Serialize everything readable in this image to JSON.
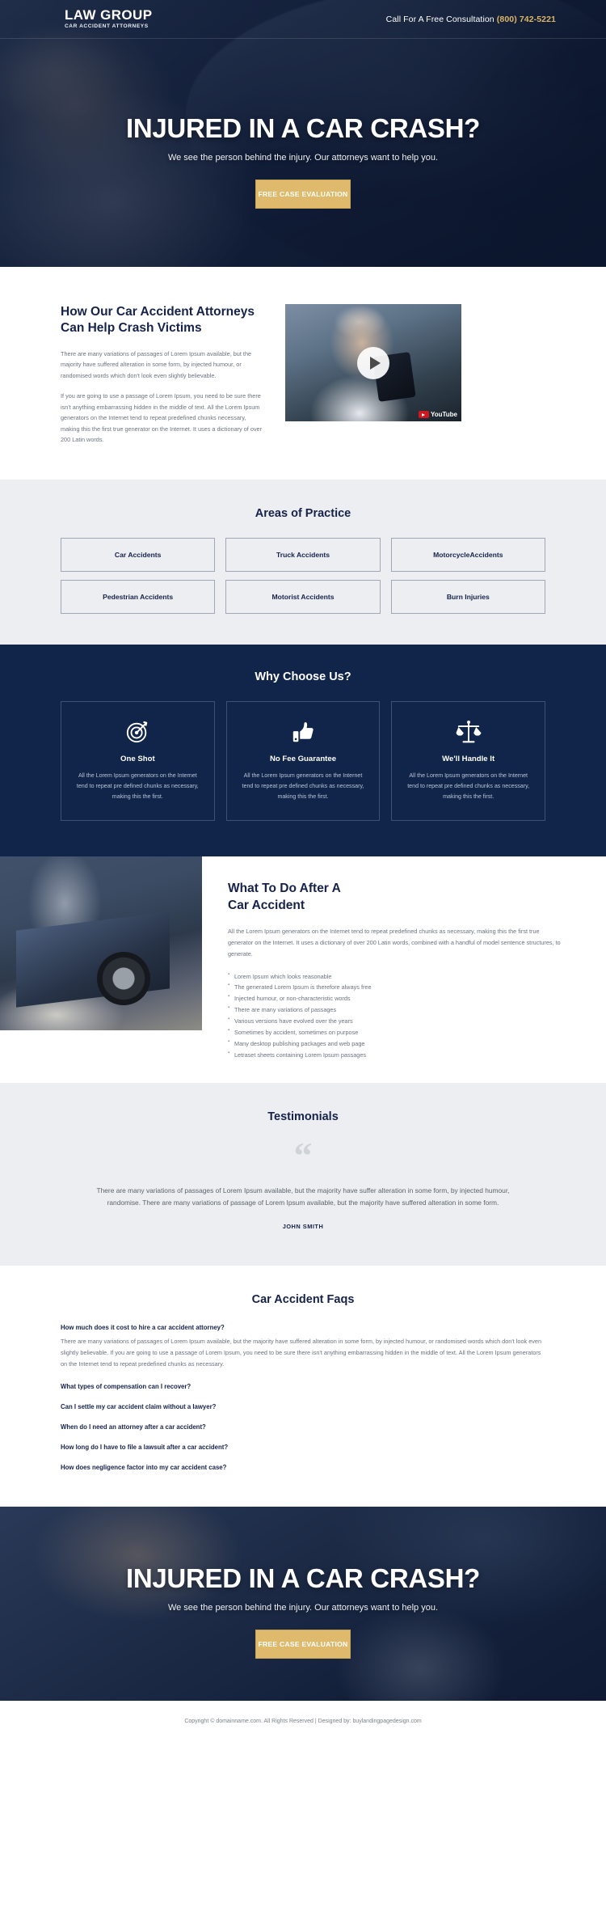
{
  "header": {
    "brand_name": "LAW GROUP",
    "brand_sub": "CAR ACCIDENT ATTORNEYS",
    "call_label": "Call For A Free Consultation",
    "phone": "(800) 742-5221"
  },
  "hero": {
    "title": "INJURED IN A CAR CRASH?",
    "subtitle": "We see the person behind the injury. Our attorneys want to help you.",
    "cta_label": "FREE CASE EVALUATION"
  },
  "help": {
    "heading": "How Our Car Accident Attorneys Can Help Crash Victims",
    "paragraph1": "There are many variations of passages of Lorem Ipsum available, but the majority have suffered alteration in some form, by injected humour, or randomised words which don't look even slightly believable.",
    "paragraph2": "If you are going to use a passage of Lorem Ipsum, you need to be sure there isn't anything embarrassing hidden in the middle of text. All the Lorem Ipsum generators on the Internet tend to repeat predefined chunks necessary, making this the first true generator on the Internet. It uses a dictionary of over 200 Latin words.",
    "video_brand": "YouTube"
  },
  "areas": {
    "heading": "Areas of Practice",
    "items": [
      "Car Accidents",
      "Truck Accidents",
      "MotorcycleAccidents",
      "Pedestrian Accidents",
      "Motorist Accidents",
      "Burn Injuries"
    ]
  },
  "why": {
    "heading": "Why Choose Us?",
    "cards": [
      {
        "icon": "target-icon",
        "title": "One Shot",
        "text": "All the Lorem Ipsum generators on the Internet tend to repeat pre defined chunks as necessary, making this the first."
      },
      {
        "icon": "thumbs-up-icon",
        "title": "No Fee Guarantee",
        "text": "All the Lorem Ipsum generators on the Internet tend to repeat pre defined chunks as necessary, making this the first."
      },
      {
        "icon": "scales-icon",
        "title": "We'll Handle It",
        "text": "All the Lorem Ipsum generators on the Internet tend to repeat pre defined chunks as necessary, making this the first."
      }
    ]
  },
  "what": {
    "heading_line1": "What To Do After A",
    "heading_line2": "Car Accident",
    "paragraph": "All the Lorem Ipsum generators on the Internet tend to repeat predefined chunks as necessary, making this the first true generator on the Internet. It uses a dictionary of over 200 Latin words, combined with a handful of model sentence structures, to generate.",
    "bullets": [
      "Lorem Ipsum which looks reasonable",
      "The generated Lorem Ipsum is therefore always free",
      "Injected humour, or non-characteristic words",
      "There are many variations of passages",
      "Various versions have evolved over the years",
      "Sometimes by accident, sometimes on purpose",
      "Many desktop publishing packages and web page",
      "Letraset sheets containing Lorem Ipsum passages"
    ]
  },
  "testimonials": {
    "heading": "Testimonials",
    "quote_glyph": "“",
    "text": "There are many variations of passages of Lorem Ipsum available, but the majority have suffer alteration in some form, by injected humour, randomise. There are many variations of passage of Lorem Ipsum available, but the majority have suffered alteration in some form.",
    "author": "JOHN SMITH"
  },
  "faq": {
    "heading": "Car Accident Faqs",
    "items": [
      {
        "question": "How much does it cost to hire a car accident attorney?",
        "answer": "There are many variations of passages of Lorem Ipsum available, but the majority have suffered alteration in some form, by injected humour, or randomised words which don't look even slightly believable. If you are going to use a passage of Lorem Ipsum, you need to be sure there isn't anything embarrassing hidden in the middle of text. All the Lorem Ipsum generators on the Internet tend to repeat predefined chunks as necessary."
      },
      {
        "question": "What types of compensation can I recover?",
        "answer": ""
      },
      {
        "question": "Can I settle my car accident claim without a lawyer?",
        "answer": ""
      },
      {
        "question": "When do I need an attorney after a car accident?",
        "answer": ""
      },
      {
        "question": "How long do I have to file a lawsuit after a car accident?",
        "answer": ""
      },
      {
        "question": "How does negligence factor into my car accident case?",
        "answer": ""
      }
    ]
  },
  "cta": {
    "title": "INJURED IN A CAR CRASH?",
    "subtitle": "We see the person behind the injury. Our attorneys want to help you.",
    "button_label": "FREE CASE EVALUATION"
  },
  "footer": {
    "text": "Copyright © domainname.com. All Rights Reserved | Designed by: buylandingpagedesign.com"
  },
  "colors": {
    "navy": "#102549",
    "gold": "#dfba6c",
    "grey_bg": "#eceef1"
  }
}
